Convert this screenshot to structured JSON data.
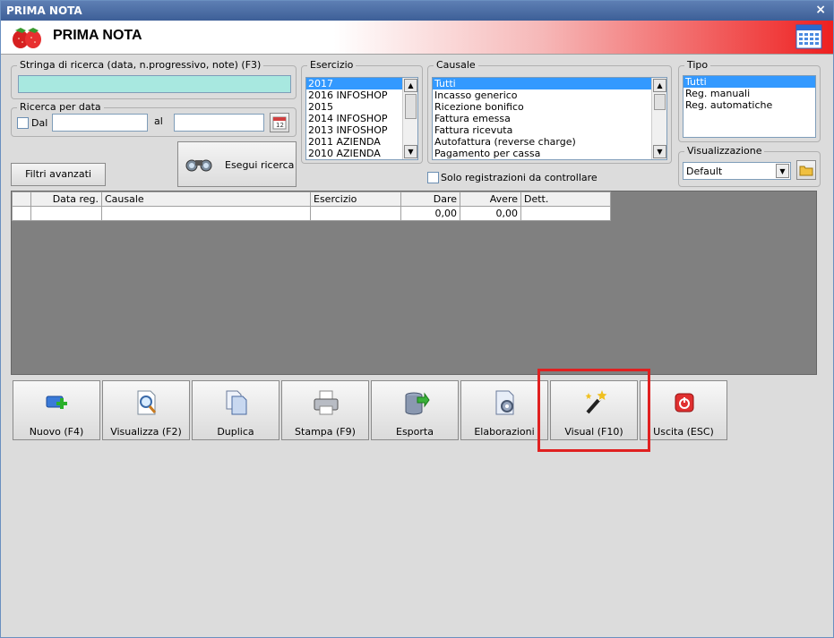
{
  "window": {
    "title": "PRIMA NOTA",
    "close": "×"
  },
  "header": {
    "title": "PRIMA NOTA"
  },
  "search": {
    "legend": "Stringa di ricerca (data, n.progressivo, note) (F3)",
    "value": ""
  },
  "date_search": {
    "legend": "Ricerca per data",
    "from_label": "Dal",
    "to_label": "al",
    "from_value": "",
    "to_value": ""
  },
  "esercizio": {
    "legend": "Esercizio",
    "items": [
      "2017",
      "2016 INFOSHOP",
      "2015",
      "2014 INFOSHOP",
      "2013 INFOSHOP",
      "2011 AZIENDA",
      "2010 AZIENDA"
    ]
  },
  "causale": {
    "legend": "Causale",
    "items": [
      "Tutti",
      "Incasso generico",
      "Ricezione bonifico",
      "Fattura emessa",
      "Fattura ricevuta",
      "Autofattura (reverse charge)",
      "Pagamento per cassa"
    ]
  },
  "tipo": {
    "legend": "Tipo",
    "items": [
      "Tutti",
      "Reg. manuali",
      "Reg. automatiche"
    ]
  },
  "visualizzazione": {
    "legend": "Visualizzazione",
    "value": "Default"
  },
  "buttons": {
    "filtri": "Filtri avanzati",
    "esegui": "Esegui ricerca",
    "solo": "Solo registrazioni da controllare"
  },
  "grid": {
    "columns": [
      "",
      "Data reg.",
      "Causale",
      "Esercizio",
      "Dare",
      "Avere",
      "Dett."
    ],
    "row": [
      "",
      "",
      "",
      "",
      "0,00",
      "0,00",
      ""
    ]
  },
  "actions": [
    {
      "label": "Nuovo (F4)",
      "icon": "new-icon"
    },
    {
      "label": "Visualizza (F2)",
      "icon": "view-icon"
    },
    {
      "label": "Duplica",
      "icon": "duplicate-icon"
    },
    {
      "label": "Stampa (F9)",
      "icon": "print-icon"
    },
    {
      "label": "Esporta",
      "icon": "export-icon"
    },
    {
      "label": "Elaborazioni",
      "icon": "process-icon"
    },
    {
      "label": "Visual (F10)",
      "icon": "magic-wand-icon"
    },
    {
      "label": "Uscita (ESC)",
      "icon": "exit-icon"
    }
  ],
  "colors": {
    "highlight": "#e02020",
    "selection": "#3399ff",
    "search_bg": "#a8e8e0"
  }
}
